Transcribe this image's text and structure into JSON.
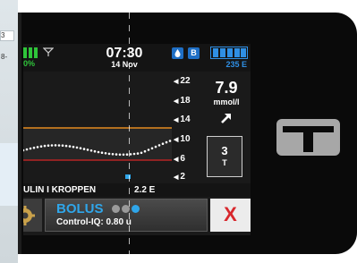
{
  "background": {
    "chip_labels": [
      "3",
      "8-"
    ]
  },
  "status": {
    "pump_battery_percent": "0%",
    "time": "07:30",
    "date": "14 Nov",
    "b_badge": "B",
    "insulin_units": "235 E"
  },
  "graph": {
    "y_ticks": [
      "22",
      "18",
      "14",
      "10",
      "6",
      "2"
    ]
  },
  "glucose": {
    "value": "7.9",
    "unit": "mmol/l",
    "trend": "rising-slowly"
  },
  "range_box": {
    "value": "3",
    "unit": "T"
  },
  "iob": {
    "label": "ULIN I KROPPEN",
    "value": "2.2 E"
  },
  "bolus": {
    "title": "BOLUS",
    "subtitle": "Control-IQ: 0.80 u",
    "dots_total": 3,
    "dots_active": 1
  },
  "cancel": {
    "label": "X"
  },
  "colors": {
    "accent_blue": "#2fa6ea",
    "battery_green": "#2fc43a",
    "target_range_orange": "#e38a1f",
    "low_limit_red": "#b52424",
    "cancel_red": "#d8272d"
  }
}
